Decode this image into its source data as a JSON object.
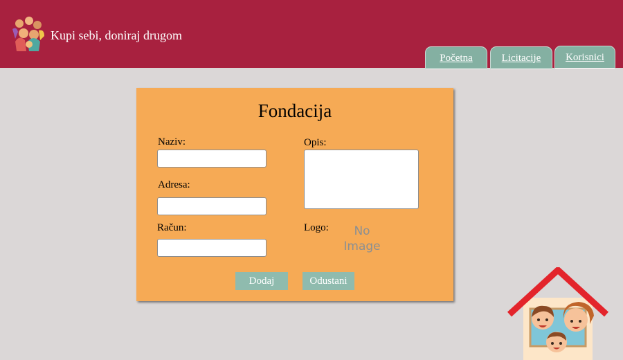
{
  "header": {
    "site_title": "Kupi sebi, doniraj drugom",
    "logo_icon": "children-group-icon",
    "background_color": "#a8213f"
  },
  "nav": {
    "tabs": [
      {
        "label": "Početna"
      },
      {
        "label": "Licitacije"
      },
      {
        "label": "Korisnici"
      }
    ],
    "tab_color": "#84b0a2"
  },
  "form": {
    "title": "Fondacija",
    "naziv_label": "Naziv:",
    "naziv_value": "",
    "adresa_label": "Adresa:",
    "adresa_value": "",
    "racun_label": "Račun:",
    "racun_value": "",
    "opis_label": "Opis:",
    "opis_value": "",
    "logo_label": "Logo:",
    "logo_placeholder": "No Image",
    "add_label": "Dodaj",
    "cancel_label": "Odustani",
    "card_color": "#f6aa55"
  },
  "decor": {
    "house_icon": "family-house-icon"
  }
}
